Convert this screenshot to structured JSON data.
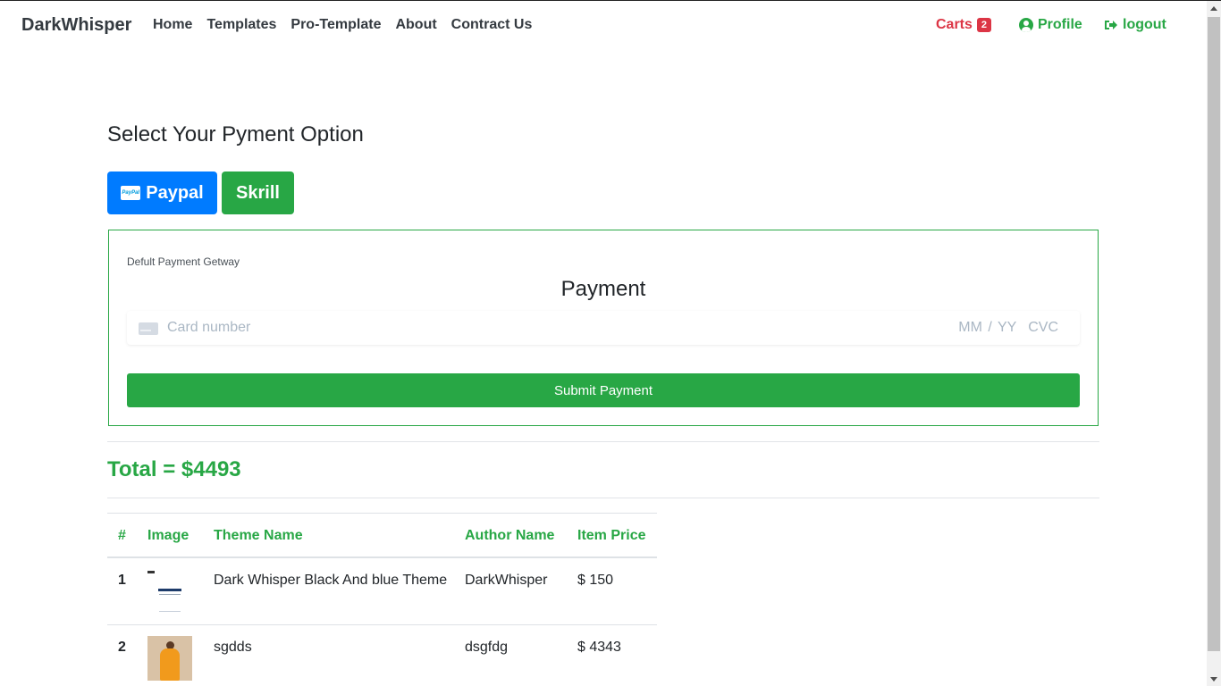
{
  "navbar": {
    "brand": "DarkWhisper",
    "links": [
      "Home",
      "Templates",
      "Pro-Template",
      "About",
      "Contract Us"
    ],
    "carts_label": "Carts",
    "carts_count": "2",
    "profile_label": "Profile",
    "logout_label": "logout"
  },
  "page": {
    "title": "Select Your Pyment Option",
    "paypal_label": "Paypal",
    "paypal_icon_text": "PayPal",
    "skrill_label": "Skrill"
  },
  "payment": {
    "gateway_label": "Defult Payment Getway",
    "title": "Payment",
    "card_placeholder": "Card number",
    "expiry_placeholder": "MM / YY",
    "cvc_placeholder": "CVC",
    "submit_label": "Submit Payment"
  },
  "total_label": "Total = $4493",
  "table": {
    "headers": [
      "#",
      "Image",
      "Theme Name",
      "Author Name",
      "Item Price"
    ],
    "rows": [
      {
        "num": "1",
        "theme": "Dark Whisper Black And blue Theme",
        "author": "DarkWhisper",
        "price": "$ 150"
      },
      {
        "num": "2",
        "theme": "sgdds",
        "author": "dsgfdg",
        "price": "$ 4343"
      }
    ]
  },
  "colors": {
    "primary": "#007bff",
    "success": "#28a745",
    "danger": "#dc3545"
  }
}
